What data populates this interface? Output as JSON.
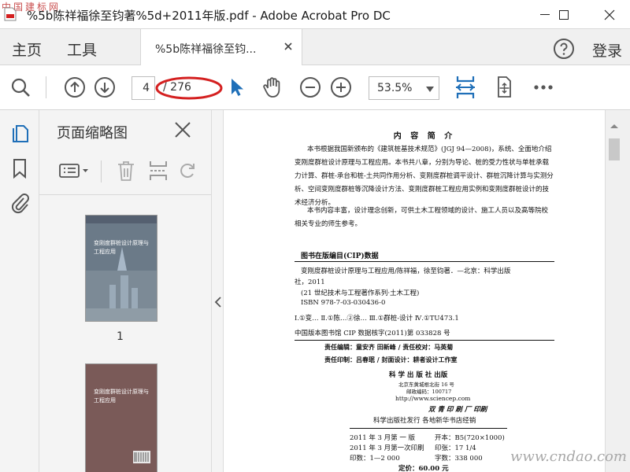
{
  "window": {
    "title": "%5b陈祥福徐至钧著%5d+2011年版.pdf - Adobe Acrobat Pro DC",
    "watermark_top": "中国建标网"
  },
  "tabs": {
    "home": "主页",
    "tools": "工具",
    "doc_tab": "%5b陈祥福徐至钧...",
    "login": "登录"
  },
  "toolbar": {
    "current_page": "4",
    "page_total": "/ 276",
    "zoom": "53.5%",
    "accent_color": "#1f6fb8",
    "annotation_color": "#d42020"
  },
  "sidebar": {
    "title": "页面缩略图",
    "thumbnails": [
      {
        "label": "1",
        "cover_title": "变刚度群桩设计原理与工程应用",
        "cover_color": "#6b7a88"
      },
      {
        "label": "2",
        "cover_title": "变刚度群桩设计原理与工程应用",
        "cover_color": "#7a5a58"
      }
    ]
  },
  "page": {
    "heading": "内 容 简 介",
    "para1": "本书根据我国新颁布的《建筑桩基技术规范》(JGJ 94—2008)，系统、全面地介绍变刚度群桩设计原理与工程应用。本书共八章，分别为导论、桩的受力性状与单桩承载力计算、群桩-承台和桩-土共同作用分析、变刚度群桩调平设计、群桩沉降计算与实测分析、空间变刚度群桩等沉降设计方法、变刚度群桩工程应用实例和变刚度群桩设计的技术经济分析。",
    "para2": "本书内容丰富，设计理念创新，可供土木工程领域的设计、施工人员以及高等院校相关专业的师生参考。",
    "cip_title": "图书在版编目(CIP)数据",
    "cip_line1": "变刚度群桩设计原理与工程应用/陈祥福，徐至钧著．—北京：科学出版",
    "cip_line2": "社，2011",
    "cip_line3": "(21 世纪技术与工程著作系列·土木工程)",
    "cip_line4": "ISBN 978-7-03-030436-0",
    "cip_line5": "Ⅰ.①变…  Ⅱ.①陈…②徐…  Ⅲ.①群桩-设计  Ⅳ.①TU473.1",
    "cip_line6": "中国版本图书馆 CIP 数据核字(2011)第 033828 号",
    "editor_line": "责任编辑：童安齐  田新峰 / 责任校对：马英菊",
    "print_line": "责任印制：吕春珉 / 封面设计：耕者设计工作室",
    "publisher": "科 学 出 版 社  出版",
    "pub_addr": "北京东黄城根北街 16 号",
    "pub_zip": "邮政编码：100717",
    "pub_web": "http://www.sciencep.com",
    "printer": "双 青 印 刷 厂 印刷",
    "distrib": "科学出版社发行    各地新华书店经销",
    "ed_left1": "2011 年 3 月第  一  版",
    "ed_right1": "开本：B5(720×1000)",
    "ed_left2": "2011 年 3 月第一次印刷",
    "ed_right2": "印张：17 1/4",
    "ed_left3": "印数：1—2 000",
    "ed_right3": "字数：338 000",
    "price": "定价：60.00 元"
  },
  "watermark_br": "www.cndao.com"
}
